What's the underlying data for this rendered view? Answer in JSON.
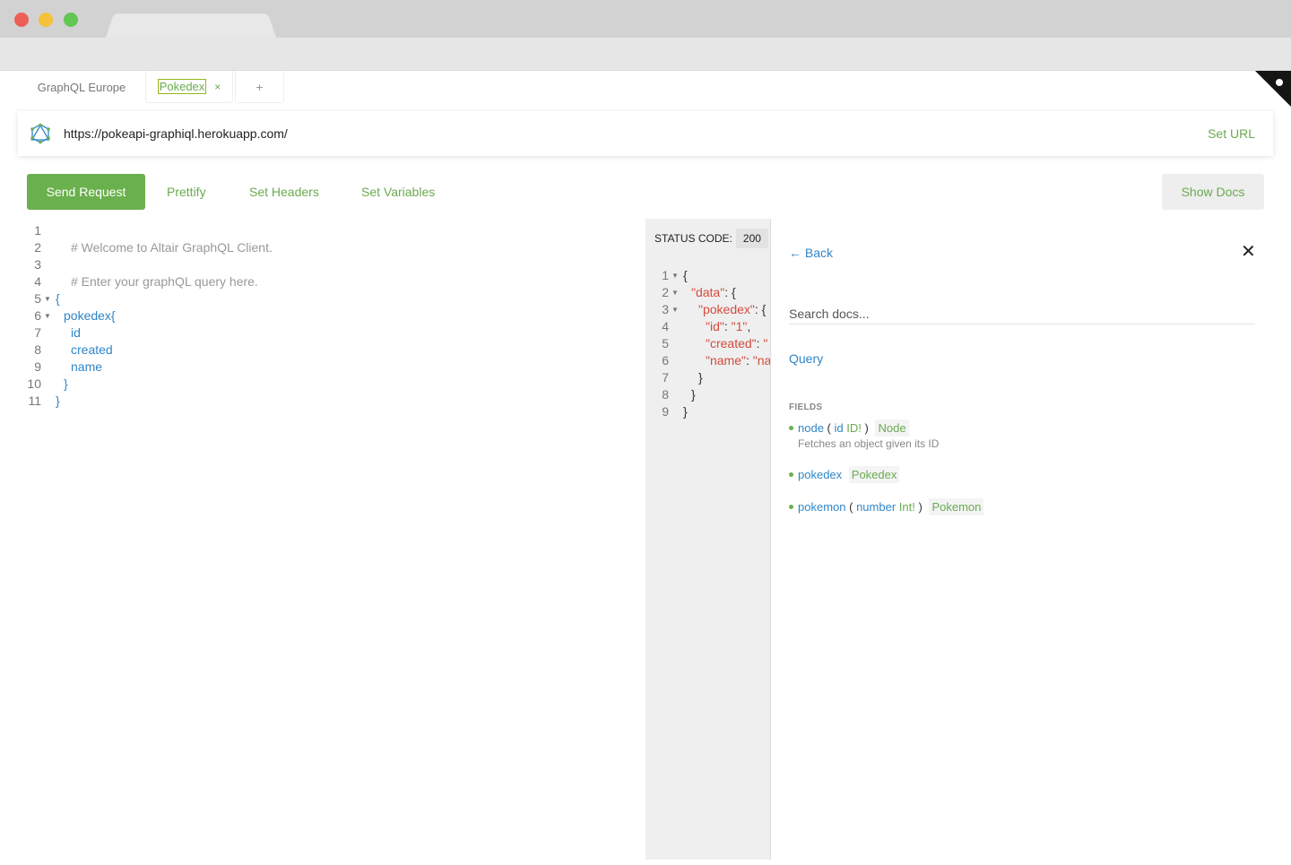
{
  "app_tabs": [
    {
      "label": "GraphQL Europe"
    },
    {
      "label": "Pokedex",
      "close": "×"
    },
    {
      "label": "+"
    }
  ],
  "url_bar": {
    "url": "https://pokeapi-graphiql.herokuapp.com/",
    "set_url_label": "Set URL"
  },
  "toolbar": {
    "send_label": "Send Request",
    "prettify_label": "Prettify",
    "headers_label": "Set Headers",
    "variables_label": "Set Variables",
    "docs_label": "Show Docs"
  },
  "editor": {
    "lines": [
      {
        "n": "1",
        "text": ""
      },
      {
        "n": "2",
        "text": "# Welcome to Altair GraphQL Client."
      },
      {
        "n": "3",
        "text": ""
      },
      {
        "n": "4",
        "text": "# Enter your graphQL query here."
      },
      {
        "n": "5",
        "text": "{"
      },
      {
        "n": "6",
        "text": "pokedex{"
      },
      {
        "n": "7",
        "text": "id"
      },
      {
        "n": "8",
        "text": "created"
      },
      {
        "n": "9",
        "text": "name"
      },
      {
        "n": "10",
        "text": "}"
      },
      {
        "n": "11",
        "text": "}"
      }
    ]
  },
  "result": {
    "status_label": "STATUS CODE:",
    "status_code": "200",
    "lines": [
      {
        "n": "1",
        "a": "{"
      },
      {
        "n": "2",
        "a": "\"data\"",
        "b": ": {"
      },
      {
        "n": "3",
        "a": "\"pokedex\"",
        "b": ": {"
      },
      {
        "n": "4",
        "a": "\"id\"",
        "b": ": ",
        "c": "\"1\"",
        "d": ","
      },
      {
        "n": "5",
        "a": "\"created\"",
        "b": ": ",
        "c": "\""
      },
      {
        "n": "6",
        "a": "\"name\"",
        "b": ": ",
        "c": "\"na"
      },
      {
        "n": "7",
        "a": "}"
      },
      {
        "n": "8",
        "a": "}"
      },
      {
        "n": "9",
        "a": "}"
      }
    ]
  },
  "docs": {
    "back_label": "← Back",
    "close_label": "✕",
    "search_placeholder": "Search docs...",
    "type_name": "Query",
    "fields_title": "FIELDS",
    "fields": [
      {
        "name": "node",
        "open": "(",
        "arg": "id",
        "arg_type": "ID!",
        "close": ")",
        "type": "Node",
        "description": "Fetches an object given its ID"
      },
      {
        "name": "pokedex",
        "type": "Pokedex"
      },
      {
        "name": "pokemon",
        "open": "(",
        "arg": "number",
        "arg_type": "Int!",
        "close": ")",
        "type": "Pokemon"
      }
    ]
  },
  "colors": {
    "accent": "#6ab04c",
    "link": "#2f86c9",
    "string": "#d44b3e"
  }
}
